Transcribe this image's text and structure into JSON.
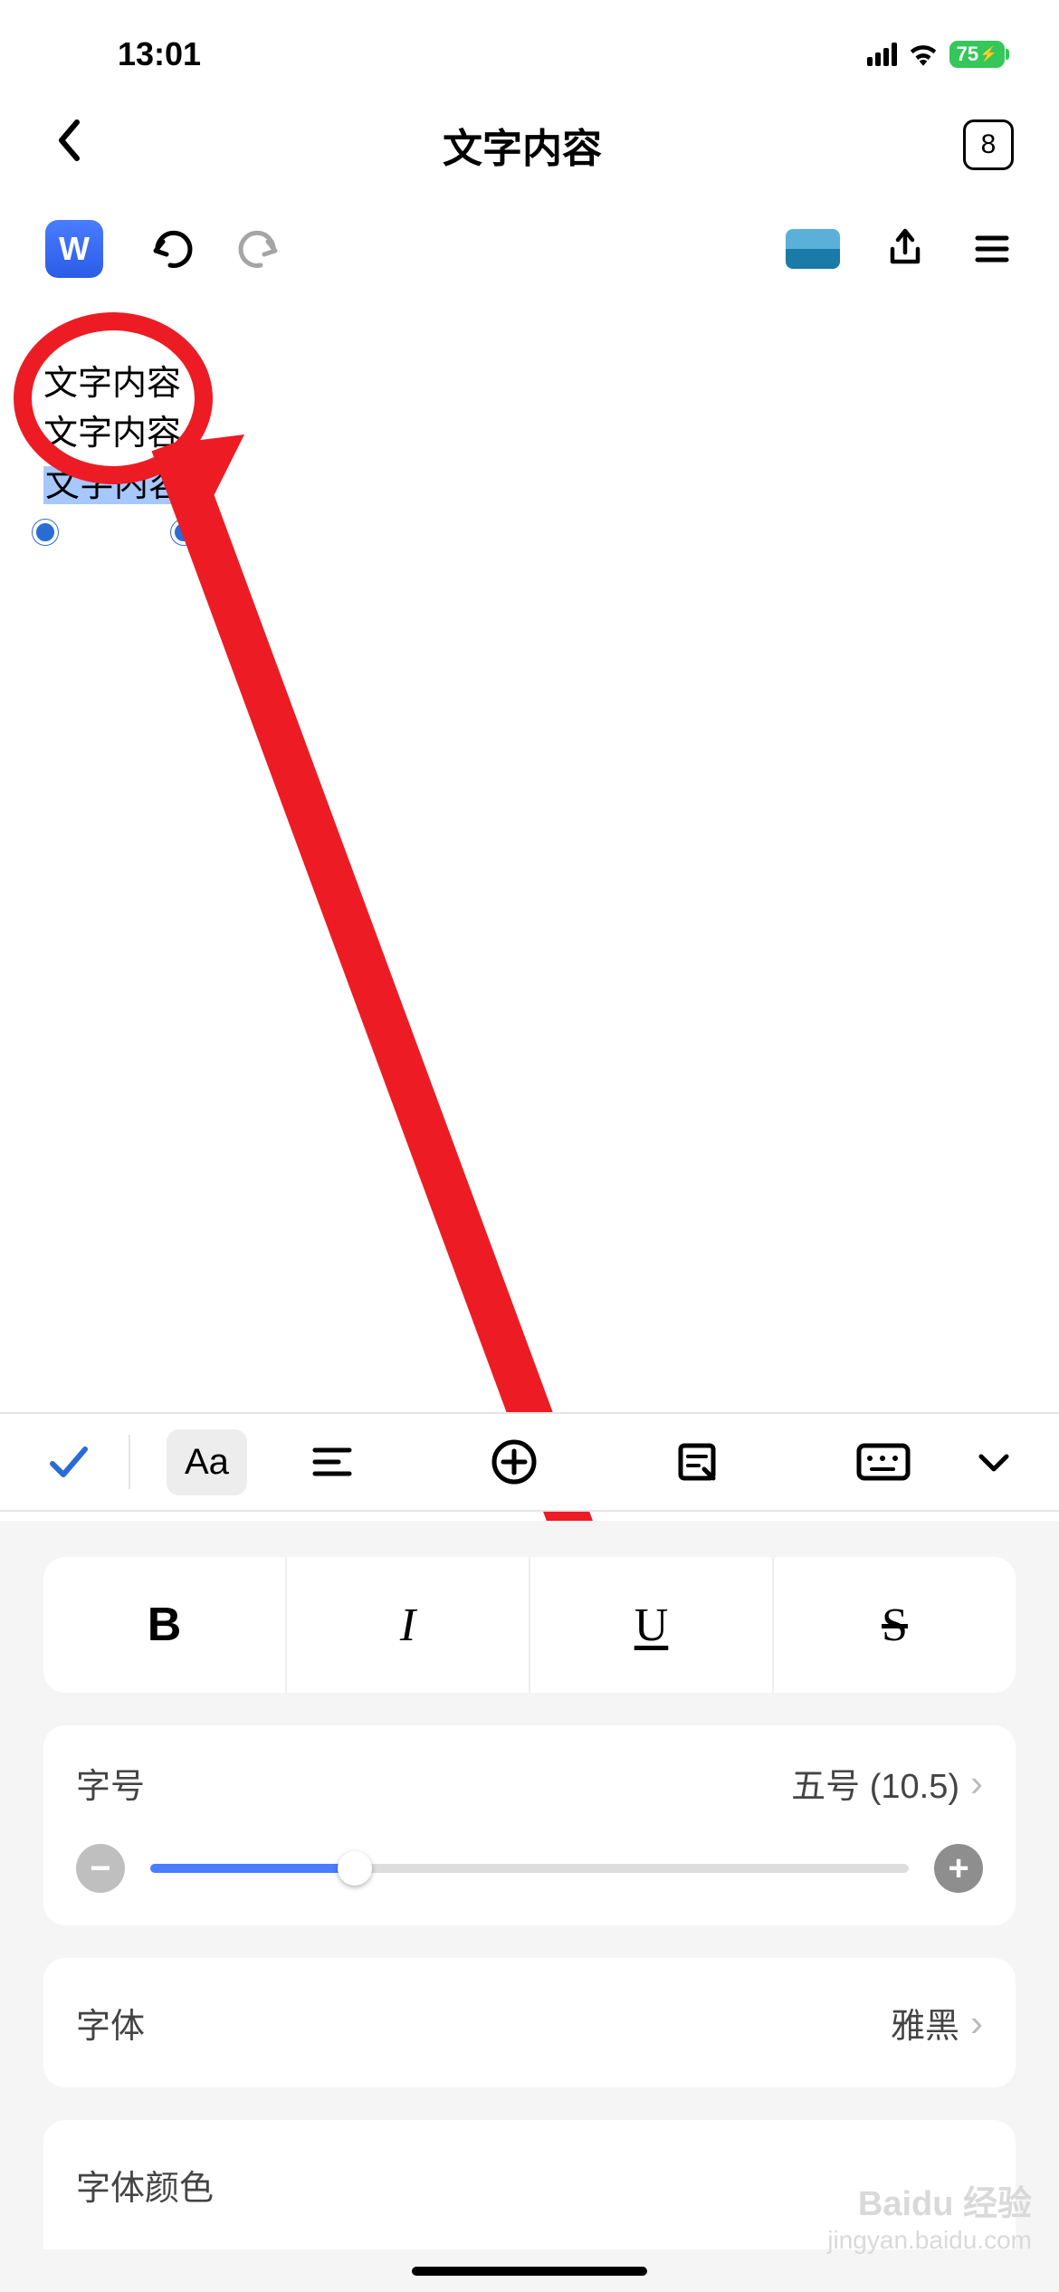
{
  "status": {
    "time": "13:01",
    "battery": "75"
  },
  "nav": {
    "title": "文字内容",
    "tab_count": "8"
  },
  "toolbar": {
    "app_letter": "W"
  },
  "document": {
    "line1": "文字内容",
    "line2": "文字内容",
    "selected": "文字内容"
  },
  "format_tabs": {
    "aa": "Aa"
  },
  "styles": {
    "bold": "B",
    "italic": "I",
    "underline": "U",
    "strike": "S"
  },
  "size": {
    "label": "字号",
    "value": "五号 (10.5)"
  },
  "font": {
    "label": "字体",
    "value": "雅黑"
  },
  "color": {
    "label": "字体颜色"
  },
  "watermark": {
    "main": "Baidu 经验",
    "sub": "jingyan.baidu.com"
  }
}
